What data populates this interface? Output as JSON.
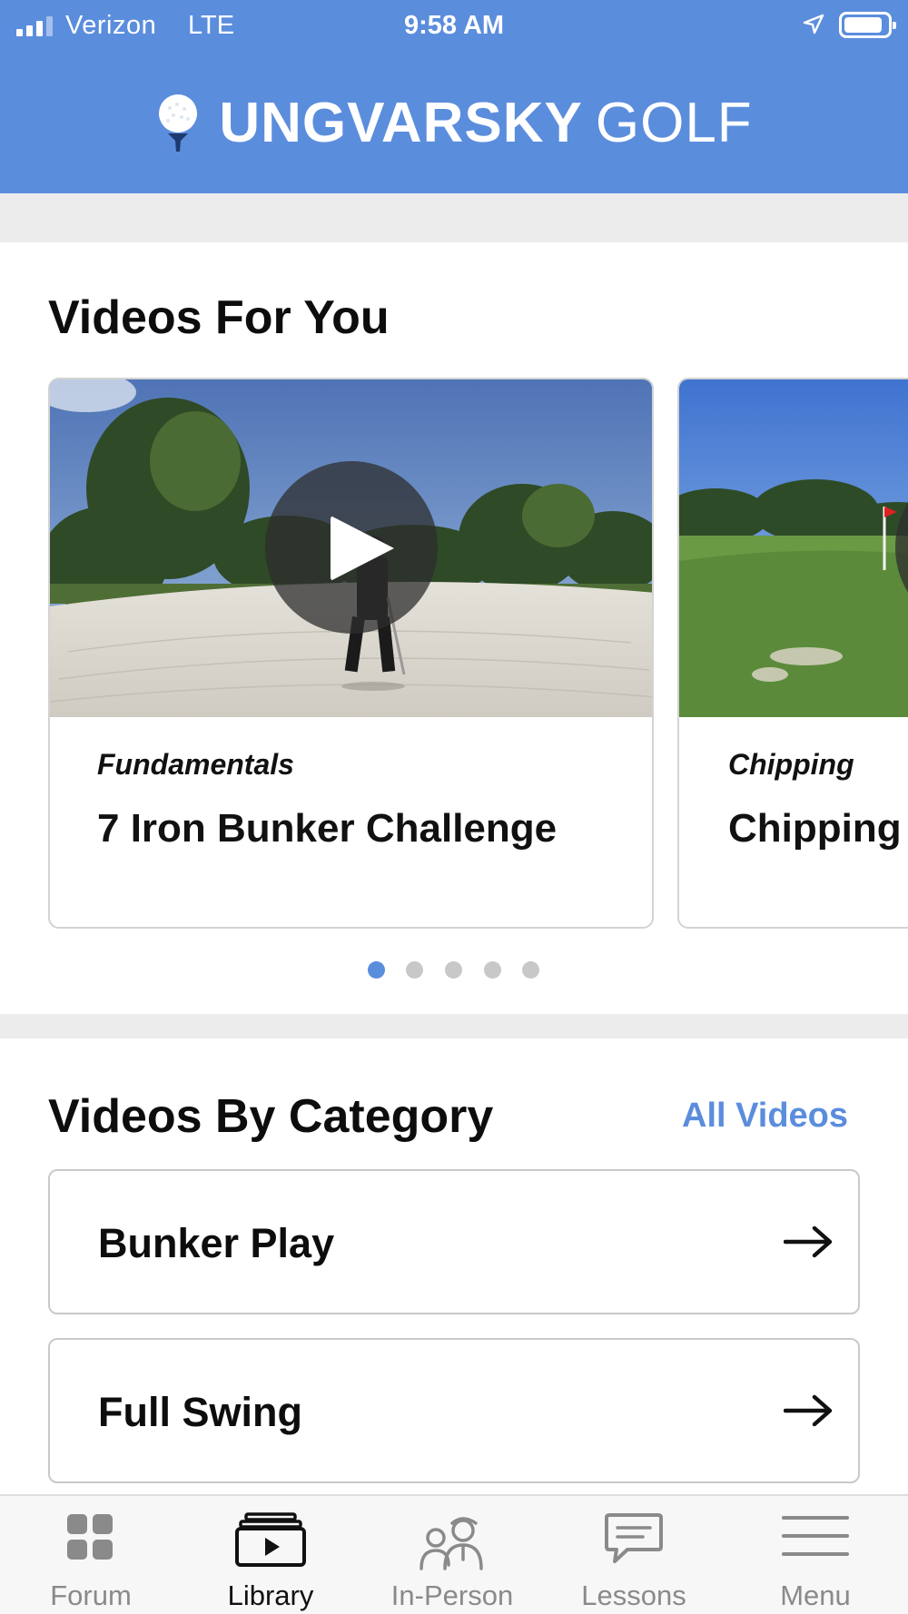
{
  "status_bar": {
    "carrier": "Verizon",
    "network": "LTE",
    "time": "9:58 AM",
    "battery_level": 0.9,
    "icons": [
      "signal-icon",
      "location-arrow-icon",
      "battery-icon"
    ]
  },
  "brand": {
    "name_bold": "UNGVARSKY",
    "name_light": "GOLF",
    "logo_icon": "golf-ball-on-tee-icon"
  },
  "colors": {
    "accent": "#5b8ddd",
    "band": "#ececec",
    "text": "#111111",
    "inactive_tab": "#8a8a8a"
  },
  "videos_for_you": {
    "title": "Videos For You",
    "cards": [
      {
        "category": "Fundamentals",
        "title": "7 Iron Bunker Challenge",
        "thumbnail": "golfer-in-bunker-photo",
        "icon": "play-icon"
      },
      {
        "category": "Chipping",
        "title": "Chipping",
        "thumbnail": "putting-green-flag-photo",
        "icon": "play-icon"
      }
    ],
    "pagination": {
      "count": 5,
      "active_index": 0
    }
  },
  "videos_by_category": {
    "title": "Videos By Category",
    "all_link": "All Videos",
    "items": [
      {
        "label": "Bunker Play",
        "icon": "arrow-right-icon"
      },
      {
        "label": "Full Swing",
        "icon": "arrow-right-icon"
      }
    ]
  },
  "tabbar": {
    "active": "Library",
    "tabs": [
      {
        "label": "Forum",
        "icon": "grid-icon"
      },
      {
        "label": "Library",
        "icon": "video-library-icon"
      },
      {
        "label": "In-Person",
        "icon": "instructor-icon"
      },
      {
        "label": "Lessons",
        "icon": "chat-bubble-icon"
      },
      {
        "label": "Menu",
        "icon": "hamburger-menu-icon"
      }
    ]
  }
}
